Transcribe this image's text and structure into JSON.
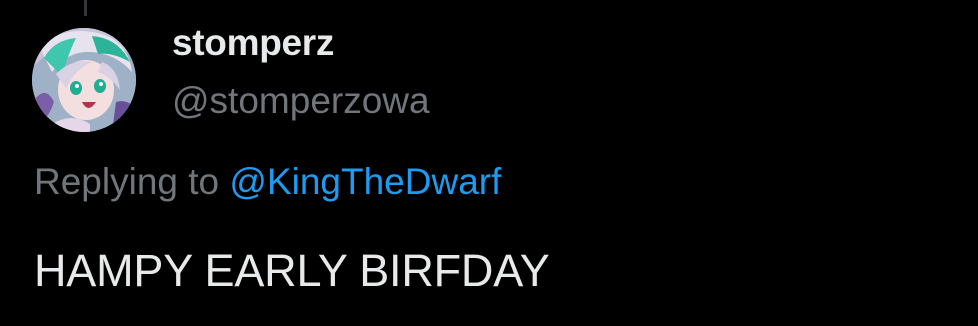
{
  "tweet": {
    "author": {
      "display_name": "stomperz",
      "handle": "@stomperzowa",
      "avatar_icon": "anime-avatar"
    },
    "reply": {
      "prefix": "Replying to ",
      "mention": "@KingTheDwarf"
    },
    "text": "HAMPY EARLY BIRFDAY"
  },
  "colors": {
    "background": "#000000",
    "primary_text": "#e7e9ea",
    "secondary_text": "#71767b",
    "link": "#1d9bf0"
  }
}
